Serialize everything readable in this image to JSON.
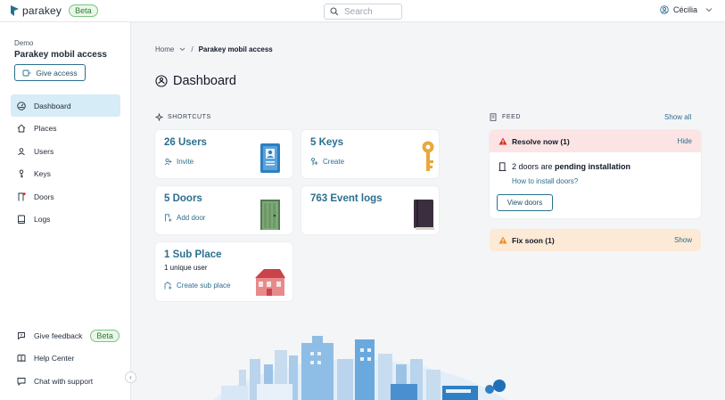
{
  "app": {
    "name": "parakey",
    "beta_badge": "Beta"
  },
  "search": {
    "placeholder": "Search"
  },
  "user": {
    "name": "Cécilia"
  },
  "org": {
    "label": "Demo",
    "name": "Parakey mobil access"
  },
  "give_access_label": "Give access",
  "nav": [
    {
      "label": "Dashboard",
      "icon": "dashboard-icon",
      "active": true
    },
    {
      "label": "Places",
      "icon": "home-icon"
    },
    {
      "label": "Users",
      "icon": "users-icon"
    },
    {
      "label": "Keys",
      "icon": "key-icon"
    },
    {
      "label": "Doors",
      "icon": "door-icon"
    },
    {
      "label": "Logs",
      "icon": "logs-icon"
    }
  ],
  "bottom_nav": [
    {
      "label": "Give feedback",
      "icon": "feedback-icon",
      "badge": "Beta"
    },
    {
      "label": "Help Center",
      "icon": "book-icon"
    },
    {
      "label": "Chat with support",
      "icon": "chat-icon"
    }
  ],
  "breadcrumb": {
    "home": "Home",
    "separator": "/",
    "current": "Parakey mobil access"
  },
  "page_title": "Dashboard",
  "shortcuts": {
    "label": "SHORTCUTS",
    "cards": [
      {
        "title": "26 Users",
        "action": "Invite"
      },
      {
        "title": "5 Keys",
        "action": "Create"
      },
      {
        "title": "5 Doors",
        "action": "Add door"
      },
      {
        "title": "763 Event logs"
      },
      {
        "title": "1 Sub Place",
        "subtitle": "1 unique user",
        "action": "Create sub place"
      }
    ]
  },
  "feed": {
    "label": "FEED",
    "show_all": "Show all",
    "resolve": {
      "title": "Resolve now (1)",
      "action": "Hide",
      "text_prefix": "2 doors are",
      "text_bold": "pending installation",
      "link": "How to install doors?",
      "button": "View doors"
    },
    "fix": {
      "title": "Fix soon (1)",
      "action": "Show"
    }
  },
  "colors": {
    "accent": "#2b6f8f",
    "active_nav": "#d6ecf7",
    "alert": "#d93025",
    "warning": "#ef8a1e"
  }
}
